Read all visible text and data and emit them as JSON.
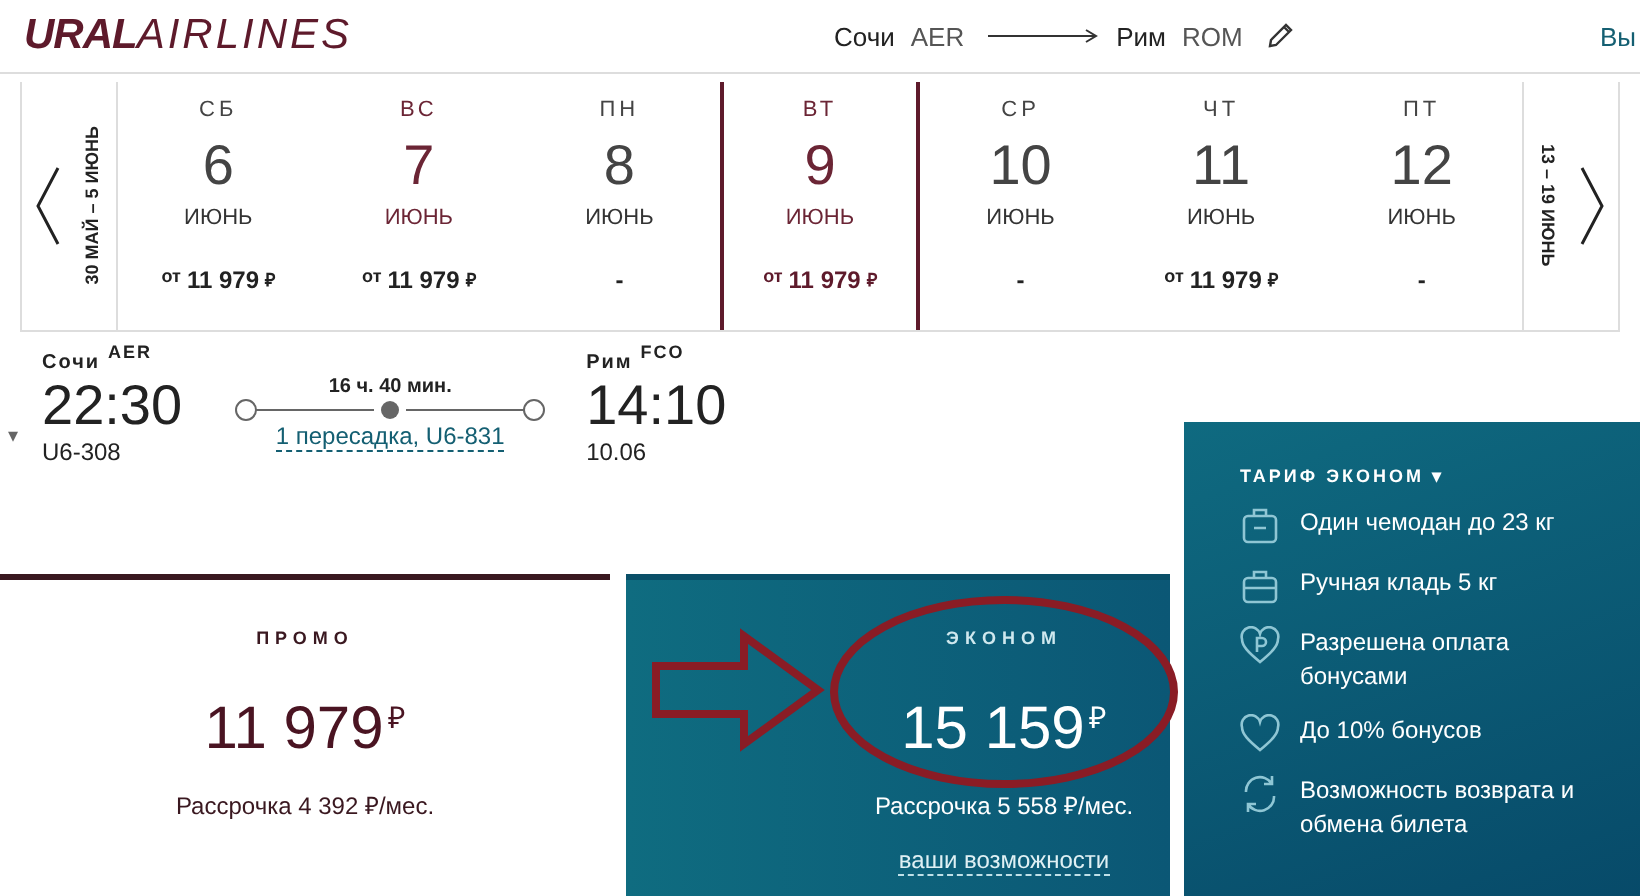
{
  "header": {
    "logo": {
      "bold": "URAL",
      "light": "AIRLINES"
    },
    "route": {
      "from_city": "Сочи",
      "from_code": "AER",
      "to_city": "Рим",
      "to_code": "ROM"
    },
    "login": "Вы"
  },
  "date_strip": {
    "prev_range": "30 МАЙ – 5 ИЮНЬ",
    "next_range": "13 – 19 ИЮНЬ",
    "days": [
      {
        "weekday": "СБ",
        "day": "6",
        "month": "ИЮНЬ",
        "prefix": "от",
        "price": "11 979",
        "currency": "₽",
        "weekend": false,
        "selected": false
      },
      {
        "weekday": "ВС",
        "day": "7",
        "month": "ИЮНЬ",
        "prefix": "от",
        "price": "11 979",
        "currency": "₽",
        "weekend": true,
        "selected": false
      },
      {
        "weekday": "ПН",
        "day": "8",
        "month": "ИЮНЬ",
        "price": "-",
        "weekend": false,
        "selected": false
      },
      {
        "weekday": "ВТ",
        "day": "9",
        "month": "ИЮНЬ",
        "prefix": "от",
        "price": "11 979",
        "currency": "₽",
        "weekend": false,
        "selected": true
      },
      {
        "weekday": "СР",
        "day": "10",
        "month": "ИЮНЬ",
        "price": "-",
        "weekend": false,
        "selected": false
      },
      {
        "weekday": "ЧТ",
        "day": "11",
        "month": "ИЮНЬ",
        "prefix": "от",
        "price": "11 979",
        "currency": "₽",
        "weekend": false,
        "selected": false
      },
      {
        "weekday": "ПТ",
        "day": "12",
        "month": "ИЮНЬ",
        "price": "-",
        "weekend": false,
        "selected": false
      }
    ]
  },
  "flight": {
    "expand": "▾",
    "departure": {
      "city": "Сочи",
      "code": "AER",
      "time": "22:30",
      "detail": "U6-308"
    },
    "duration": "16 ч. 40 мин.",
    "transfer": "1 пересадка, U6-831",
    "arrival": {
      "city": "Рим",
      "code": "FCO",
      "time": "14:10",
      "detail": "10.06"
    }
  },
  "fares": [
    {
      "name": "ПРОМО",
      "price": "11 979",
      "currency": "₽",
      "installment": "Рассрочка 4 392 ₽/мес.",
      "selected": false
    },
    {
      "name": "ЭКОНОМ",
      "price": "15 159",
      "currency": "₽",
      "installment": "Рассрочка 5 558 ₽/мес.",
      "link": "ваши возможности",
      "selected": true
    }
  ],
  "tariff": {
    "title": "ТАРИФ ЭКОНОМ ▾",
    "features": [
      {
        "kind": "suitcase",
        "text": "Один чемодан до 23 кг"
      },
      {
        "kind": "bag",
        "text": "Ручная кладь 5 кг"
      },
      {
        "kind": "bonus",
        "text": "Разрешена оплата бонусами"
      },
      {
        "kind": "heart",
        "text": "До 10% бонусов"
      },
      {
        "kind": "refresh",
        "text": "Возможность возврата и обмена билета"
      }
    ]
  },
  "annotations": [
    {
      "kind": "arrow"
    },
    {
      "kind": "ellipse"
    }
  ]
}
